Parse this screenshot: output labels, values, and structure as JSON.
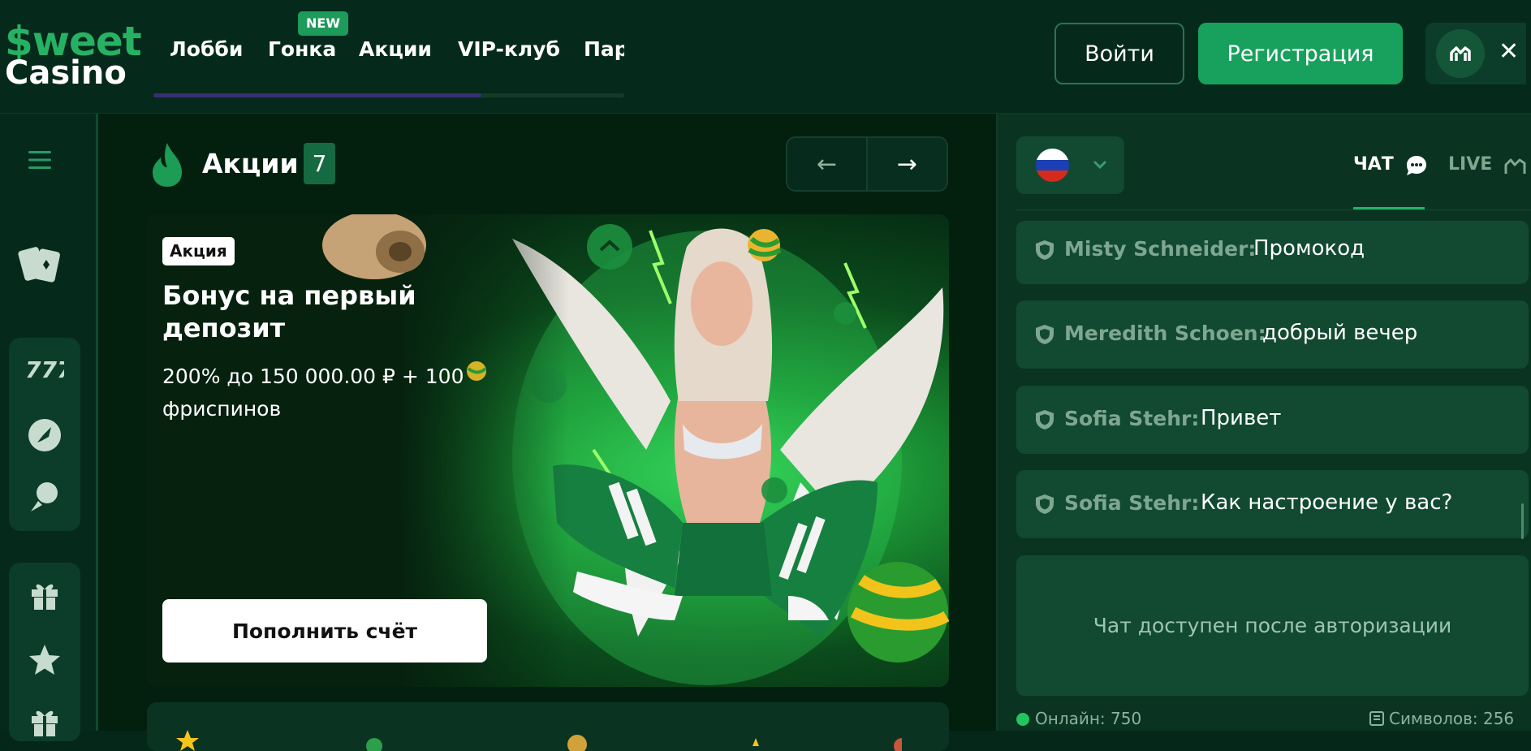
{
  "header": {
    "logo_top": "$weet",
    "logo_bottom": "Casino",
    "nav": [
      {
        "label": "Лобби"
      },
      {
        "label": "Гонка",
        "badge": "NEW"
      },
      {
        "label": "Акции"
      },
      {
        "label": "VIP-клуб"
      },
      {
        "label": "Пар"
      }
    ],
    "login_label": "Войти",
    "register_label": "Регистрация",
    "close_glyph": "✕"
  },
  "sidebar": {
    "icons": [
      "menu-icon",
      "cards-icon",
      "slots-777-icon",
      "rocket-icon",
      "sports-icon",
      "gift-icon",
      "star-icon",
      "gift-icon"
    ]
  },
  "main": {
    "section_title": "Акции",
    "section_count": "7",
    "prev_arrow": "←",
    "next_arrow": "→",
    "promo": {
      "tag": "Акция",
      "title": "Бонус на первый депозит",
      "description": "200% до 150 000.00 ₽ + 100 фриспинов",
      "cta_label": "Пополнить счёт"
    }
  },
  "chat": {
    "tab_chat": "ЧАТ",
    "tab_live": "LIVE",
    "messages": [
      {
        "user": "Misty Schneider:",
        "text": "Промокод"
      },
      {
        "user": "Meredith Schoen:",
        "text": "добрый вечер"
      },
      {
        "user": "Sofia Stehr:",
        "text": "Привет"
      },
      {
        "user": "Sofia Stehr:",
        "text": "Как настроение у вас?"
      }
    ],
    "locked_text": "Чат доступен после авторизации",
    "online_label": "Онлайн: 750",
    "symbols_label": "Символов: 256"
  },
  "colors": {
    "background": "#05271a",
    "accent": "#18a15d",
    "panel": "#114a31",
    "muted_text": "#7fa790"
  }
}
